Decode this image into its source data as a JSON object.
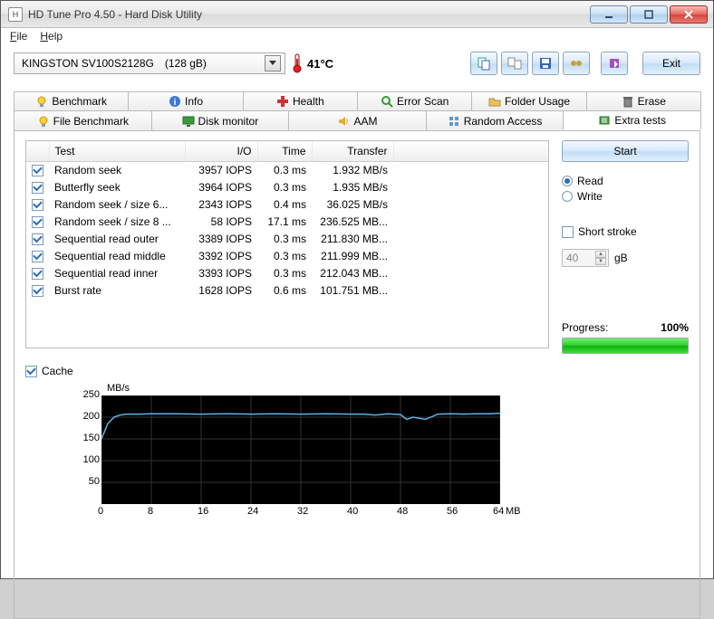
{
  "window": {
    "title": "HD Tune Pro 4.50 - Hard Disk Utility"
  },
  "menu": {
    "file": "File",
    "help": "Help"
  },
  "drive": {
    "name": "KINGSTON SV100S2128G",
    "size": "(128 gB)"
  },
  "temperature": "41°C",
  "exit_label": "Exit",
  "tabs_row1": [
    {
      "label": "Benchmark",
      "icon": "bulb"
    },
    {
      "label": "Info",
      "icon": "info"
    },
    {
      "label": "Health",
      "icon": "plus-red"
    },
    {
      "label": "Error Scan",
      "icon": "magnify"
    },
    {
      "label": "Folder Usage",
      "icon": "folder"
    },
    {
      "label": "Erase",
      "icon": "trash"
    }
  ],
  "tabs_row2": [
    {
      "label": "File Benchmark",
      "icon": "bulb"
    },
    {
      "label": "Disk monitor",
      "icon": "monitor"
    },
    {
      "label": "AAM",
      "icon": "speaker"
    },
    {
      "label": "Random Access",
      "icon": "random"
    },
    {
      "label": "Extra tests",
      "icon": "extra",
      "active": true
    }
  ],
  "table": {
    "headers": {
      "test": "Test",
      "io": "I/O",
      "time": "Time",
      "transfer": "Transfer"
    },
    "rows": [
      {
        "test": "Random seek",
        "io": "3957 IOPS",
        "time": "0.3 ms",
        "transfer": "1.932 MB/s"
      },
      {
        "test": "Butterfly seek",
        "io": "3964 IOPS",
        "time": "0.3 ms",
        "transfer": "1.935 MB/s"
      },
      {
        "test": "Random seek / size 6...",
        "io": "2343 IOPS",
        "time": "0.4 ms",
        "transfer": "36.025 MB/s"
      },
      {
        "test": "Random seek / size 8 ...",
        "io": "58 IOPS",
        "time": "17.1 ms",
        "transfer": "236.525 MB..."
      },
      {
        "test": "Sequential read outer",
        "io": "3389 IOPS",
        "time": "0.3 ms",
        "transfer": "211.830 MB..."
      },
      {
        "test": "Sequential read middle",
        "io": "3392 IOPS",
        "time": "0.3 ms",
        "transfer": "211.999 MB..."
      },
      {
        "test": "Sequential read inner",
        "io": "3393 IOPS",
        "time": "0.3 ms",
        "transfer": "212.043 MB..."
      },
      {
        "test": "Burst rate",
        "io": "1628 IOPS",
        "time": "0.6 ms",
        "transfer": "101.751 MB..."
      }
    ]
  },
  "start_label": "Start",
  "mode": {
    "read": "Read",
    "write": "Write"
  },
  "short_stroke": {
    "label": "Short stroke",
    "value": "40",
    "unit": "gB"
  },
  "progress": {
    "label": "Progress:",
    "value": "100%",
    "percent": 100
  },
  "cache_label": "Cache",
  "chart_data": {
    "type": "line",
    "title": "",
    "ylabel": "MB/s",
    "xlabel": "MB",
    "ylim": [
      0,
      250
    ],
    "xlim": [
      0,
      64
    ],
    "yticks": [
      50,
      100,
      150,
      200,
      250
    ],
    "xticks": [
      0,
      8,
      16,
      24,
      32,
      40,
      48,
      56,
      64
    ],
    "series": [
      {
        "name": "cache",
        "x": [
          0,
          1,
          2,
          3,
          4,
          6,
          8,
          12,
          16,
          20,
          24,
          28,
          32,
          36,
          40,
          42,
          44,
          46,
          48,
          49,
          50,
          52,
          54,
          56,
          58,
          60,
          62,
          64
        ],
        "y": [
          150,
          185,
          200,
          205,
          207,
          207,
          208,
          208,
          207,
          208,
          207,
          208,
          207,
          208,
          207,
          207,
          205,
          208,
          206,
          195,
          200,
          195,
          207,
          208,
          207,
          208,
          208,
          209
        ]
      }
    ]
  }
}
